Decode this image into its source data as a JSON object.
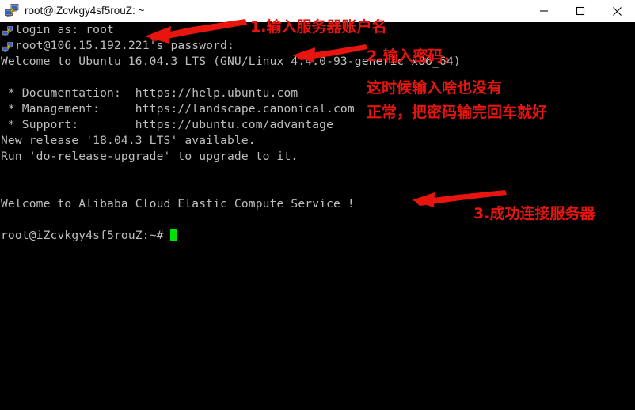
{
  "window": {
    "title": "root@iZcvkgy4sf5rouZ: ~",
    "icon": "putty-icon",
    "titlebar_bg": "#ffffff",
    "terminal_bg": "#000000",
    "terminal_fg": "#bfbfbf",
    "cursor_color": "#00e000",
    "annotation_color": "#e8150f",
    "controls": {
      "minimize": "minimize-icon",
      "maximize": "maximize-icon",
      "close": "close-icon"
    }
  },
  "terminal": {
    "lines": [
      "  login as: root",
      "  root@106.15.192.221's password:",
      "Welcome to Ubuntu 16.04.3 LTS (GNU/Linux 4.4.0-93-generic x86_64)",
      "",
      " * Documentation:  https://help.ubuntu.com",
      " * Management:     https://landscape.canonical.com",
      " * Support:        https://ubuntu.com/advantage",
      "New release '18.04.3 LTS' available.",
      "Run 'do-release-upgrade' to upgrade to it.",
      "",
      "",
      "Welcome to Alibaba Cloud Elastic Compute Service !",
      "",
      "root@iZcvkgy4sf5rouZ:~# "
    ],
    "prompt_line_index": 13,
    "cursor": "block-cursor"
  },
  "annotations": [
    {
      "id": "annot-step-1",
      "text": "1.输入服务器账户名"
    },
    {
      "id": "annot-step-2-line1",
      "text": "2.输入密码，"
    },
    {
      "id": "annot-step-2-line2",
      "text": "这时候输入啥也没有"
    },
    {
      "id": "annot-step-2-line3",
      "text": "正常，把密码输完回车就好"
    },
    {
      "id": "annot-step-3",
      "text": "3.成功连接服务器"
    }
  ]
}
